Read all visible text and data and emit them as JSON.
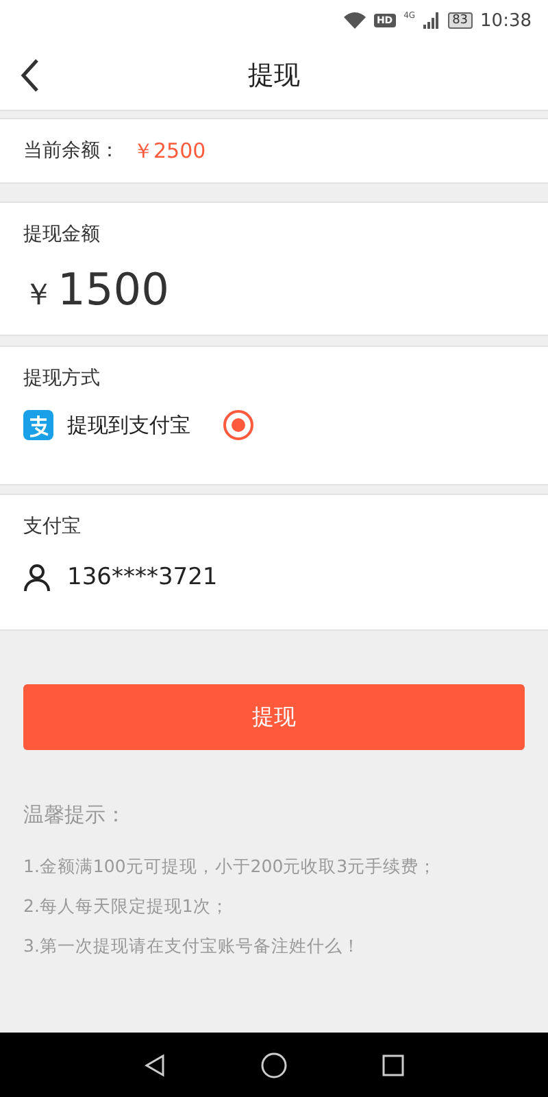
{
  "status_bar": {
    "hd_badge": "HD",
    "network": "4G",
    "battery": "83",
    "time": "10:38"
  },
  "header": {
    "title": "提现"
  },
  "balance": {
    "label": "当前余额：",
    "value": "￥2500"
  },
  "amount": {
    "label": "提现金额",
    "currency": "￥",
    "value": "1500"
  },
  "method": {
    "label": "提现方式",
    "options": [
      {
        "label": "提现到支付宝",
        "selected": true
      }
    ]
  },
  "account": {
    "label": "支付宝",
    "value": "136****3721"
  },
  "submit_button": "提现",
  "tips": {
    "title": "温馨提示：",
    "items": [
      "1.金额满100元可提现，小于200元收取3元手续费；",
      "2.每人每天限定提现1次；",
      "3.第一次提现请在支付宝账号备注姓什么！"
    ]
  }
}
